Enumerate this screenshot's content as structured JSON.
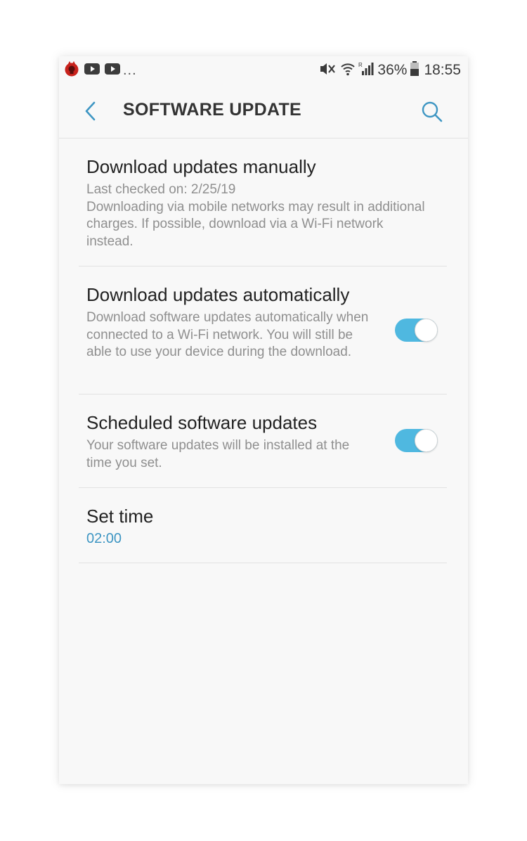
{
  "status_bar": {
    "app_icons": [
      "app-icon",
      "youtube-icon",
      "youtube-icon"
    ],
    "more": "...",
    "battery": "36%",
    "time": "18:55"
  },
  "header": {
    "title": "SOFTWARE UPDATE"
  },
  "items": [
    {
      "title": "Download updates manually",
      "subtitle": "Last checked on: 2/25/19\nDownloading via mobile networks may result in additional charges. If possible, download via a Wi-Fi network instead."
    },
    {
      "title": "Download updates automatically",
      "subtitle": "Download software updates automatically when connected to a Wi-Fi network. You will still be able to use your device during the download.",
      "toggle_on": true
    },
    {
      "title": "Scheduled software updates",
      "subtitle": "Your software updates will be installed at the time you set.",
      "toggle_on": true
    },
    {
      "title": "Set time",
      "value": "02:00"
    }
  ],
  "colors": {
    "accent": "#3e96c3",
    "toggle_on": "#4fb8e0",
    "background": "#f8f8f8"
  }
}
